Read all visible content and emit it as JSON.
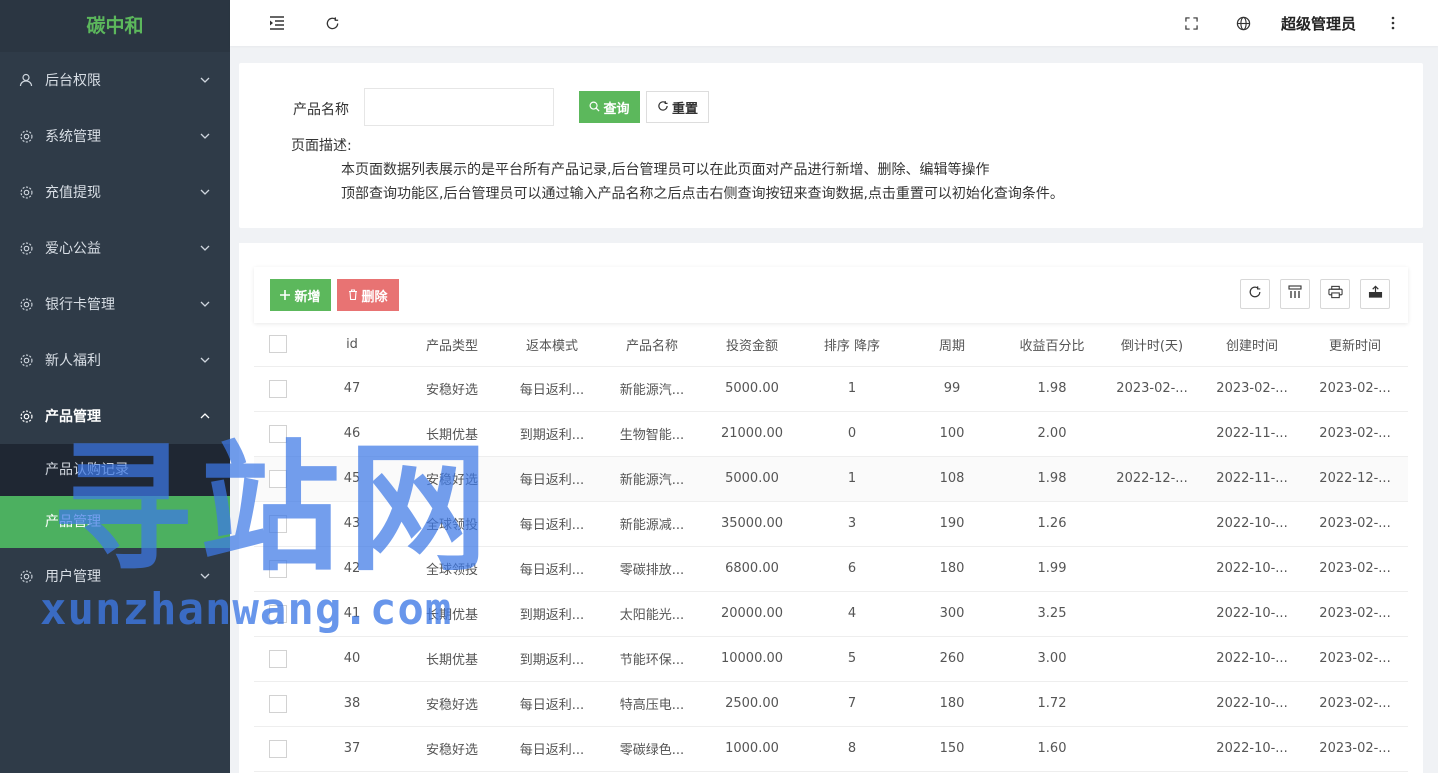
{
  "brand": "碳中和",
  "sidebar": {
    "items": [
      {
        "label": "后台权限",
        "icon": "user-icon"
      },
      {
        "label": "系统管理",
        "icon": "gear-icon"
      },
      {
        "label": "充值提现",
        "icon": "gear-icon"
      },
      {
        "label": "爱心公益",
        "icon": "gear-icon"
      },
      {
        "label": "银行卡管理",
        "icon": "gear-icon"
      },
      {
        "label": "新人福利",
        "icon": "gear-icon"
      },
      {
        "label": "产品管理",
        "icon": "gear-icon",
        "open": true
      },
      {
        "label": "用户管理",
        "icon": "gear-icon"
      }
    ],
    "submenu": [
      {
        "label": "产品认购记录"
      },
      {
        "label": "产品管理",
        "active": true
      }
    ]
  },
  "header": {
    "user": "超级管理员"
  },
  "search": {
    "label": "产品名称",
    "value": "",
    "query_label": "查询",
    "reset_label": "重置"
  },
  "description": {
    "title": "页面描述:",
    "line1": "本页面数据列表展示的是平台所有产品记录,后台管理员可以在此页面对产品进行新增、删除、编辑等操作",
    "line2": "顶部查询功能区,后台管理员可以通过输入产品名称之后点击右侧查询按钮来查询数据,点击重置可以初始化查询条件。"
  },
  "toolbar": {
    "add_label": "新增",
    "delete_label": "删除"
  },
  "table": {
    "columns": [
      "id",
      "产品类型",
      "返本模式",
      "产品名称",
      "投资金额",
      "排序 降序",
      "周期",
      "收益百分比",
      "倒计时(天)",
      "创建时间",
      "更新时间"
    ],
    "rows": [
      [
        "47",
        "安稳好选",
        "每日返利...",
        "新能源汽...",
        "5000.00",
        "1",
        "99",
        "1.98",
        "2023-02-...",
        "2023-02-...",
        "2023-02-..."
      ],
      [
        "46",
        "长期优基",
        "到期返利...",
        "生物智能...",
        "21000.00",
        "0",
        "100",
        "2.00",
        "",
        "2022-11-...",
        "2023-02-..."
      ],
      [
        "45",
        "安稳好选",
        "每日返利...",
        "新能源汽...",
        "5000.00",
        "1",
        "108",
        "1.98",
        "2022-12-...",
        "2022-11-...",
        "2022-12-..."
      ],
      [
        "43",
        "全球领投",
        "每日返利...",
        "新能源减...",
        "35000.00",
        "3",
        "190",
        "1.26",
        "",
        "2022-10-...",
        "2023-02-..."
      ],
      [
        "42",
        "全球领投",
        "每日返利...",
        "零碳排放...",
        "6800.00",
        "6",
        "180",
        "1.99",
        "",
        "2022-10-...",
        "2023-02-..."
      ],
      [
        "41",
        "长期优基",
        "到期返利...",
        "太阳能光...",
        "20000.00",
        "4",
        "300",
        "3.25",
        "",
        "2022-10-...",
        "2023-02-..."
      ],
      [
        "40",
        "长期优基",
        "到期返利...",
        "节能环保...",
        "10000.00",
        "5",
        "260",
        "3.00",
        "",
        "2022-10-...",
        "2023-02-..."
      ],
      [
        "38",
        "安稳好选",
        "每日返利...",
        "特高压电...",
        "2500.00",
        "7",
        "180",
        "1.72",
        "",
        "2022-10-...",
        "2023-02-..."
      ],
      [
        "37",
        "安稳好选",
        "每日返利...",
        "零碳绿色...",
        "1000.00",
        "8",
        "150",
        "1.60",
        "",
        "2022-10-...",
        "2023-02-..."
      ]
    ]
  },
  "watermark": {
    "big": "寻站网",
    "small": "xunzhanwang.com"
  },
  "colors": {
    "sidebar_bg": "#2f3b48",
    "brand": "#5cb85c",
    "active_green": "#4cb060",
    "delete_red": "#e87373",
    "watermark": "#3d78e6"
  }
}
